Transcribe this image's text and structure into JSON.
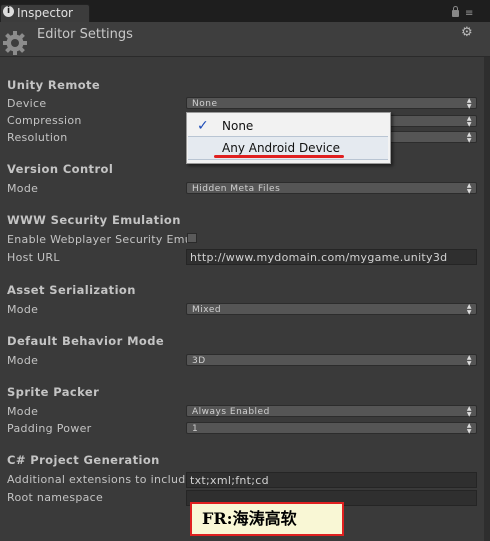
{
  "tab": {
    "icon": "info-icon",
    "label": "Inspector"
  },
  "header": {
    "title": "Editor Settings",
    "icon": "gear-icon"
  },
  "unity_remote": {
    "heading": "Unity Remote",
    "device_label": "Device",
    "device_value": "None",
    "compression_label": "Compression",
    "resolution_label": "Resolution"
  },
  "device_dropdown": {
    "options": [
      {
        "label": "None",
        "checked": true
      },
      {
        "label": "Any Android Device",
        "checked": false
      }
    ]
  },
  "version_control": {
    "heading": "Version Control",
    "mode_label": "Mode",
    "mode_value": "Hidden Meta Files"
  },
  "www_security": {
    "heading": "WWW Security Emulation",
    "enable_label": "Enable Webplayer Security Emu",
    "host_label": "Host URL",
    "host_value": "http://www.mydomain.com/mygame.unity3d"
  },
  "asset_serialization": {
    "heading": "Asset Serialization",
    "mode_label": "Mode",
    "mode_value": "Mixed"
  },
  "default_behavior": {
    "heading": "Default Behavior Mode",
    "mode_label": "Mode",
    "mode_value": "3D"
  },
  "sprite_packer": {
    "heading": "Sprite Packer",
    "mode_label": "Mode",
    "mode_value": "Always Enabled",
    "padding_label": "Padding Power",
    "padding_value": "1"
  },
  "csharp": {
    "heading": "C# Project Generation",
    "extensions_label": "Additional extensions to include",
    "extensions_value": "txt;xml;fnt;cd",
    "namespace_label": "Root namespace",
    "namespace_value": ""
  },
  "watermark": "FR:海涛高软",
  "colors": {
    "panel": "#3a3a3a",
    "dropdown_check": "#1d4cb8",
    "annotation_red": "#e02020"
  }
}
